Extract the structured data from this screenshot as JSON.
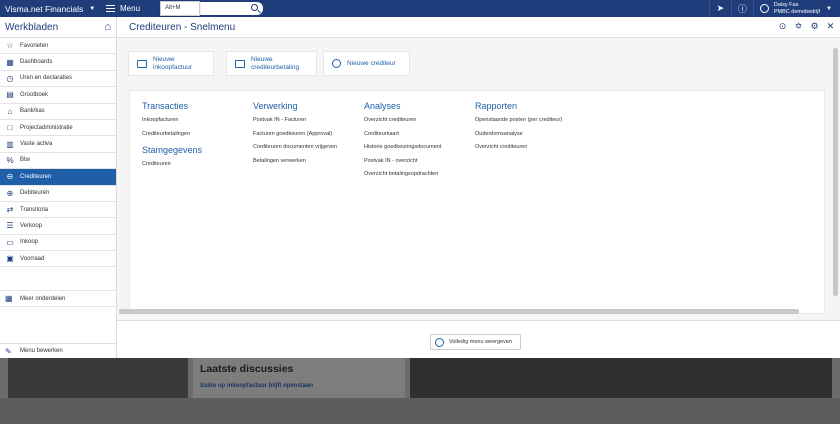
{
  "topbar": {
    "brand": "Visma.net Financials",
    "menu_label": "Menu",
    "search_placeholder": "",
    "shortcut_tooltip": "Alt+M",
    "user_name": "Daisy Fas",
    "user_company": "PMBC demobedrijf"
  },
  "sidebar": {
    "title": "Werkbladen",
    "items": [
      {
        "label": "Favorieten",
        "icon": "star-icon"
      },
      {
        "label": "Dashboards",
        "icon": "dashboard-icon"
      },
      {
        "label": "Uren en declaraties",
        "icon": "clock-icon"
      },
      {
        "label": "Grootboek",
        "icon": "book-icon"
      },
      {
        "label": "Bank/kas",
        "icon": "bank-icon"
      },
      {
        "label": "Projectadministratie",
        "icon": "folder-icon"
      },
      {
        "label": "Vaste activa",
        "icon": "building-icon"
      },
      {
        "label": "Btw",
        "icon": "percent-icon"
      },
      {
        "label": "Crediteuren",
        "icon": "minus-circle-icon"
      },
      {
        "label": "Debiteuren",
        "icon": "plus-circle-icon"
      },
      {
        "label": "Transitoria",
        "icon": "transfer-icon"
      },
      {
        "label": "Verkoop",
        "icon": "cart-icon"
      },
      {
        "label": "Inkoop",
        "icon": "truck-icon"
      },
      {
        "label": "Voorraad",
        "icon": "boxes-icon"
      }
    ],
    "active_index": 8,
    "more_label": "Meer onderdelen",
    "edit_label": "Menu bewerken"
  },
  "panel": {
    "title": "Crediteuren - Snelmenu",
    "quick_actions": [
      {
        "line1": "Nieuwe",
        "line2": "inkoopfactuur"
      },
      {
        "line1": "Nieuwe",
        "line2": "crediteurbetaling"
      },
      {
        "line1": "Nieuwe crediteur",
        "line2": ""
      }
    ],
    "columns": [
      {
        "heading": "Transacties",
        "links": [
          "Inkoopfacturen",
          "Crediteurbetalingen"
        ],
        "sub_heading": "Stamgegevens",
        "sub_links": [
          "Crediteuren"
        ]
      },
      {
        "heading": "Verwerking",
        "links": [
          "Postvak IN - Facturen",
          "Facturen goedkeuren (Approval)",
          "Crediteuren documenten vrijgeven",
          "Betalingen verwerken"
        ]
      },
      {
        "heading": "Analyses",
        "links": [
          "Overzicht crediteuren",
          "Crediteurkaart",
          "Historie goedkeuringsdocument",
          "Postvak IN - overzicht",
          "Overzicht betalingsopdrachten"
        ]
      },
      {
        "heading": "Rapporten",
        "links": [
          "Openstaande posten (per crediteur)",
          "Ouderdomsanalyse",
          "Overzicht crediteuren"
        ]
      }
    ],
    "full_menu_label": "Volledig menu weergeven"
  },
  "background": {
    "discussions_title": "Laatste discussies",
    "discussion_link": "Saldo op inkoopfactuur blijft openstaan"
  }
}
